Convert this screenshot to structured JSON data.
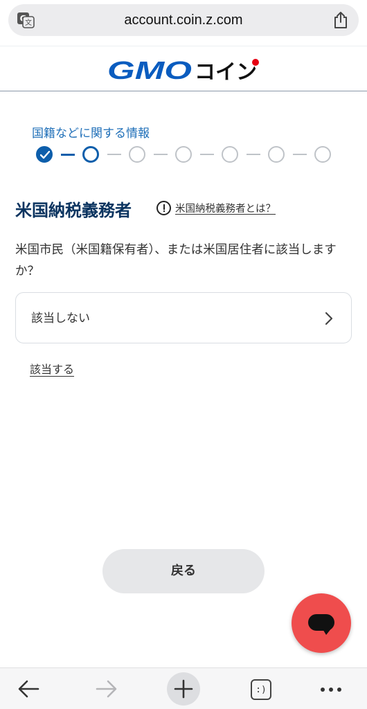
{
  "browser": {
    "url": "account.coin.z.com",
    "icons": {
      "translate": "translate-icon",
      "share": "share-icon"
    }
  },
  "header": {
    "logo_text": "GMOコイン"
  },
  "progress": {
    "section_title": "国籍などに関する情報",
    "total_steps": 7,
    "completed_steps": 1,
    "current_step": 2
  },
  "main": {
    "title": "米国納税義務者",
    "help_link": "米国納税義務者とは？",
    "question": "米国市民（米国籍保有者）、または米国居住者に該当しますか？",
    "select_value": "該当しない",
    "alt_link": "該当する",
    "back_button": "戻る"
  },
  "toolbar": {
    "tabs_label": ":)",
    "icons": [
      "back-arrow-icon",
      "forward-arrow-icon",
      "new-tab-plus-icon",
      "tabs-icon",
      "more-dots-icon"
    ]
  },
  "colors": {
    "brand_blue": "#0d5eab",
    "title_navy": "#0b3460",
    "chat_red": "#ef4d4d"
  }
}
